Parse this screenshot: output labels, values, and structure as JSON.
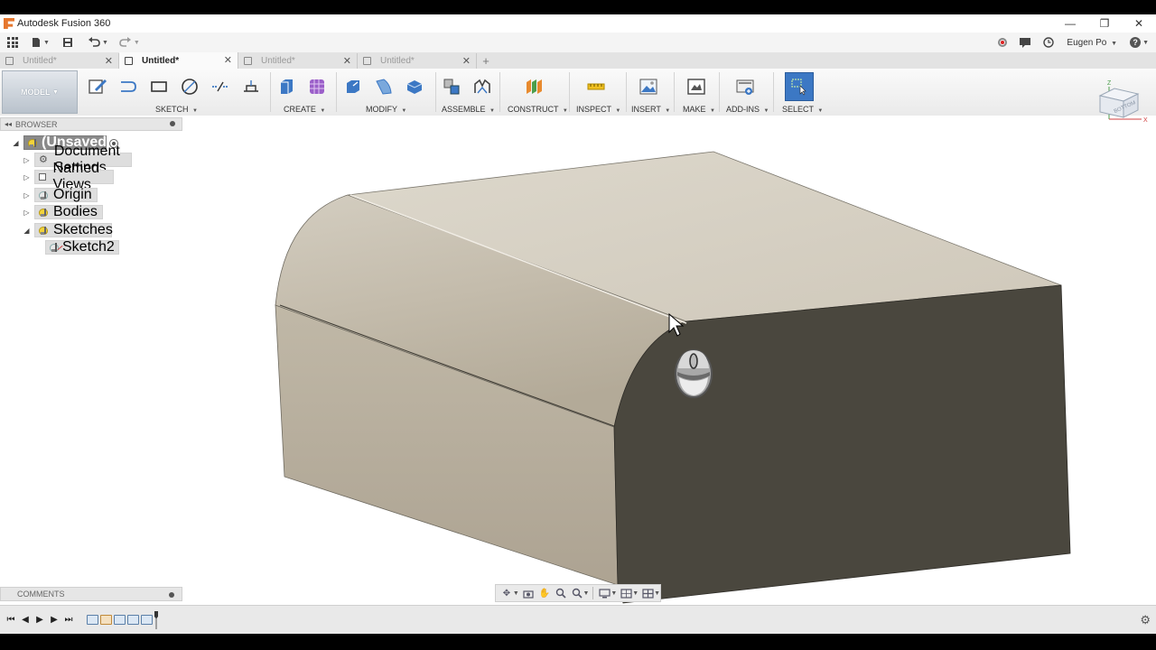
{
  "window": {
    "title": "Autodesk Fusion 360",
    "minimize": "—",
    "restore": "❐",
    "close": "✕"
  },
  "appbar": {
    "user": "Eugen Po",
    "help": "?"
  },
  "tabs": [
    {
      "label": "Untitled*",
      "active": false
    },
    {
      "label": "Untitled*",
      "active": true
    },
    {
      "label": "Untitled*",
      "active": false
    },
    {
      "label": "Untitled*",
      "active": false
    }
  ],
  "toolbar": {
    "workspace": "MODEL",
    "groups": [
      {
        "label": "SKETCH"
      },
      {
        "label": "CREATE"
      },
      {
        "label": "MODIFY"
      },
      {
        "label": "ASSEMBLE"
      },
      {
        "label": "CONSTRUCT"
      },
      {
        "label": "INSPECT"
      },
      {
        "label": "INSERT"
      },
      {
        "label": "MAKE"
      },
      {
        "label": "ADD-INS"
      },
      {
        "label": "SELECT"
      }
    ]
  },
  "viewcube": {
    "face_label": "BOTTOM",
    "axis_z": "Z",
    "axis_x": "X"
  },
  "browser": {
    "title": "BROWSER",
    "root": "(Unsaved)",
    "items": [
      {
        "label": "Document Settings"
      },
      {
        "label": "Named Views"
      },
      {
        "label": "Origin"
      },
      {
        "label": "Bodies"
      },
      {
        "label": "Sketches"
      }
    ],
    "sketch_child": "Sketch2"
  },
  "comments": {
    "title": "COMMENTS"
  },
  "colors": {
    "body_light": "#d6d0c4",
    "body_mid": "#b4aa98",
    "body_dark": "#4a473e",
    "select_blue": "#3c78c4"
  }
}
